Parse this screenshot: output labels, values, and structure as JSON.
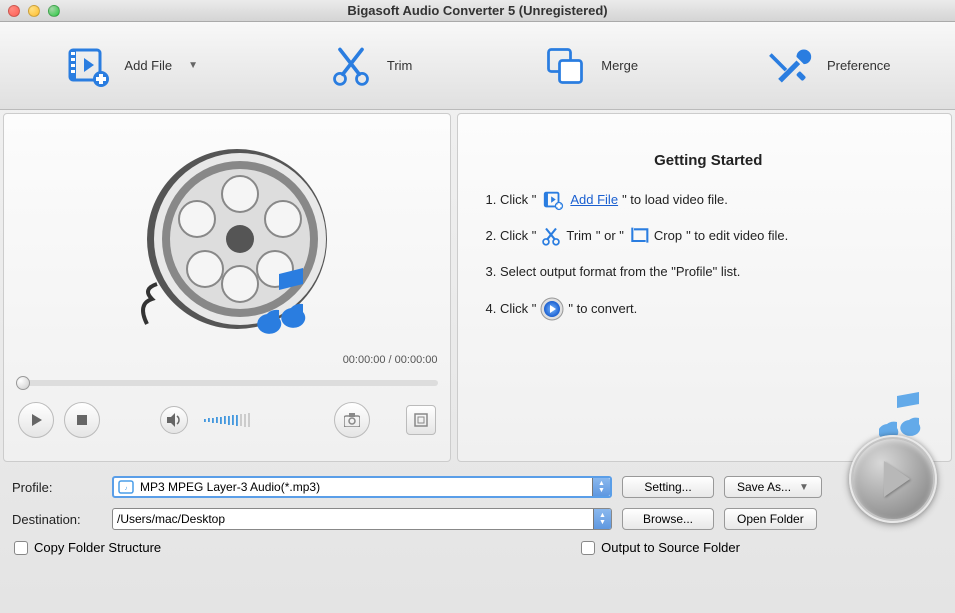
{
  "window": {
    "title": "Bigasoft Audio Converter 5 (Unregistered)"
  },
  "toolbar": {
    "add_file": "Add File",
    "trim": "Trim",
    "merge": "Merge",
    "preference": "Preference"
  },
  "preview": {
    "time": "00:00:00 / 00:00:00"
  },
  "getting_started": {
    "title": "Getting Started",
    "step1_a": "1. Click \"",
    "step1_link": " Add File ",
    "step1_b": "\" to load video file.",
    "step2_a": "2. Click \"",
    "step2_trim": "Trim",
    "step2_b": "\" or \"",
    "step2_crop": "Crop",
    "step2_c": "\" to edit video file.",
    "step3": "3. Select output format from the \"Profile\" list.",
    "step4_a": "4. Click \"",
    "step4_b": "\" to convert."
  },
  "profile": {
    "label": "Profile:",
    "value": "MP3 MPEG Layer-3 Audio(*.mp3)",
    "setting": "Setting...",
    "save_as": "Save As..."
  },
  "destination": {
    "label": "Destination:",
    "value": "/Users/mac/Desktop",
    "browse": "Browse...",
    "open": "Open Folder"
  },
  "checks": {
    "copy_structure": "Copy Folder Structure",
    "output_source": "Output to Source Folder"
  }
}
